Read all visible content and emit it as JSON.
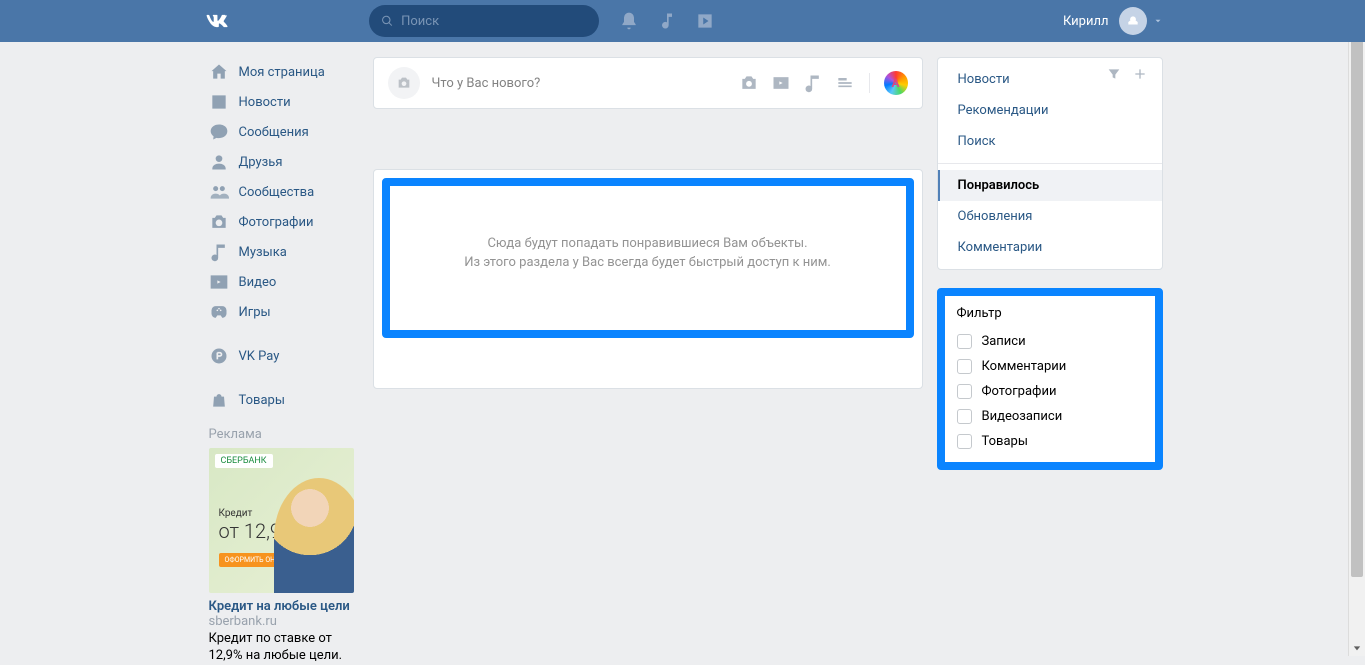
{
  "header": {
    "search_placeholder": "Поиск",
    "user_name": "Кирилл"
  },
  "left_nav": {
    "items": [
      {
        "label": "Моя страница",
        "icon": "home"
      },
      {
        "label": "Новости",
        "icon": "news"
      },
      {
        "label": "Сообщения",
        "icon": "msg"
      },
      {
        "label": "Друзья",
        "icon": "friends"
      },
      {
        "label": "Сообщества",
        "icon": "groups"
      },
      {
        "label": "Фотографии",
        "icon": "photo"
      },
      {
        "label": "Музыка",
        "icon": "music"
      },
      {
        "label": "Видео",
        "icon": "video"
      },
      {
        "label": "Игры",
        "icon": "game"
      }
    ],
    "pay": "VK Pay",
    "market": "Товары"
  },
  "ad": {
    "title": "Реклама",
    "logo": "СБЕРБАНК",
    "rate_label": "Кредит",
    "rate": "от 12,9%",
    "heading": "Кредит на любые цели",
    "domain": "sberbank.ru",
    "desc": "Кредит по ставке от 12,9% на любые цели."
  },
  "composer": {
    "placeholder": "Что у Вас нового?"
  },
  "empty": {
    "line1": "Сюда будут попадать понравившиеся Вам объекты.",
    "line2": "Из этого раздела у Вас всегда будет быстрый доступ к ним."
  },
  "side_feed": {
    "items": [
      {
        "label": "Новости"
      },
      {
        "label": "Рекомендации"
      },
      {
        "label": "Поиск"
      },
      {
        "label": "Понравилось",
        "active": true
      },
      {
        "label": "Обновления"
      },
      {
        "label": "Комментарии"
      }
    ]
  },
  "filter": {
    "title": "Фильтр",
    "options": [
      {
        "label": "Записи"
      },
      {
        "label": "Комментарии"
      },
      {
        "label": "Фотографии"
      },
      {
        "label": "Видеозаписи"
      },
      {
        "label": "Товары"
      }
    ]
  }
}
